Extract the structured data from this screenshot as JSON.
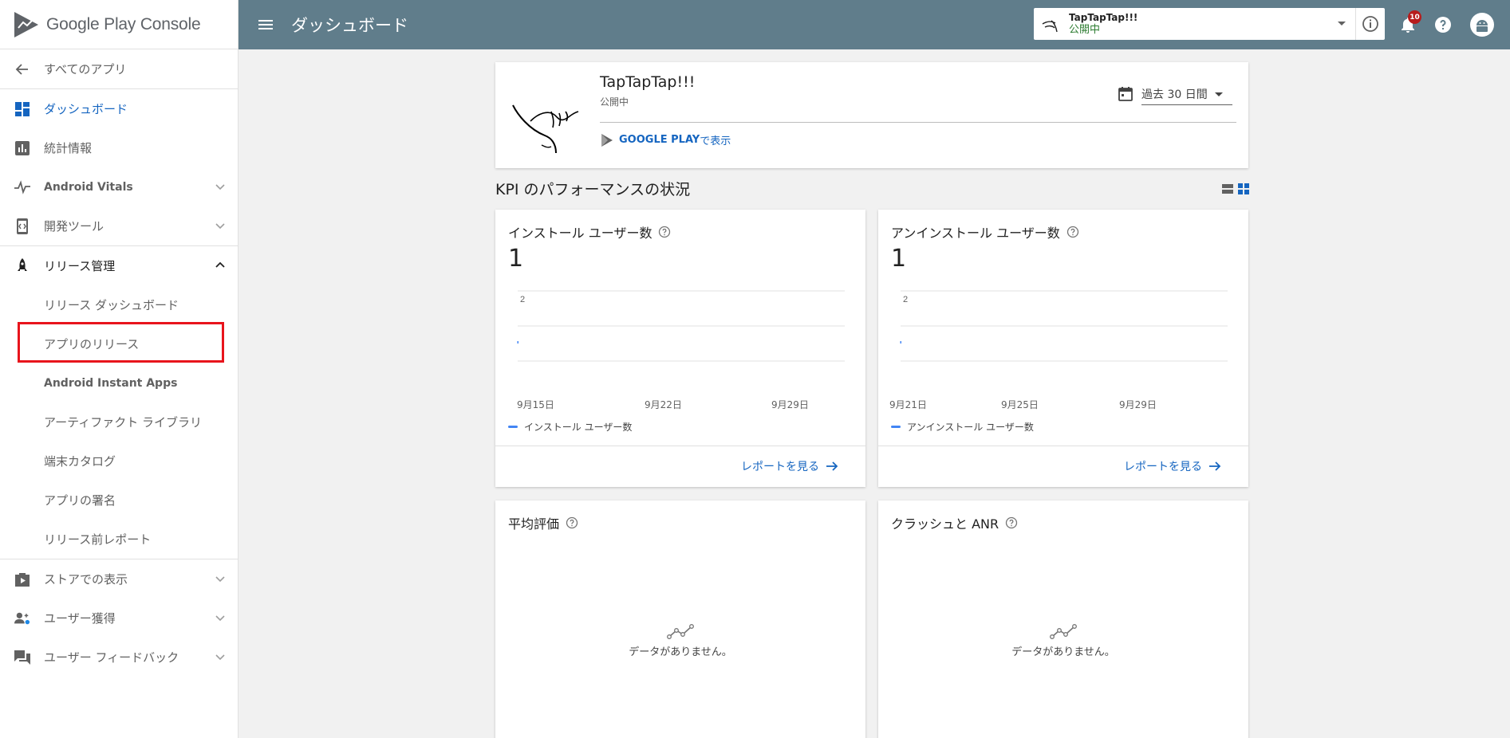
{
  "brand": {
    "logo_text": "Google Play Console"
  },
  "topbar": {
    "title": "ダッシュボード",
    "app_name": "TapTapTap!!!",
    "app_status": "公開中",
    "notification_count": "10"
  },
  "sidebar": {
    "back_label": "すべてのアプリ",
    "items": [
      {
        "label": "ダッシュボード",
        "icon": "dashboard-icon"
      },
      {
        "label": "統計情報",
        "icon": "bar-chart-icon"
      },
      {
        "label": "Android Vitals",
        "icon": "pulse-icon"
      },
      {
        "label": "開発ツール",
        "icon": "dev-tools-icon"
      },
      {
        "label": "リリース管理",
        "icon": "rocket-icon"
      }
    ],
    "release_sub": [
      "リリース ダッシュボード",
      "アプリのリリース",
      "Android Instant Apps",
      "アーティファクト ライブラリ",
      "端末カタログ",
      "アプリの署名",
      "リリース前レポート"
    ],
    "bottom_items": [
      {
        "label": "ストアでの表示",
        "icon": "store-icon"
      },
      {
        "label": "ユーザー獲得",
        "icon": "user-acquisition-icon"
      },
      {
        "label": "ユーザー フィードバック",
        "icon": "feedback-icon"
      }
    ]
  },
  "app_card": {
    "name": "TapTapTap!!!",
    "status": "公開中",
    "logo_text": "TapTapTap!!!",
    "gplay_label_bold": "GOOGLE PLAY",
    "gplay_label_rest": " で表示",
    "date_range": "過去 30 日間"
  },
  "kpi_section": {
    "title": "KPI のパフォーマンスの状況"
  },
  "kpi_cards": [
    {
      "title": "インストール ユーザー数",
      "value": "1",
      "legend": "インストール ユーザー数",
      "report_label": "レポートを見る",
      "y_tick": "2",
      "x_ticks": [
        "9月15日",
        "9月22日",
        "9月29日"
      ]
    },
    {
      "title": "アンインストール ユーザー数",
      "value": "1",
      "legend": "アンインストール ユーザー数",
      "report_label": "レポートを見る",
      "y_tick": "2",
      "x_ticks": [
        "9月21日",
        "9月25日",
        "9月29日"
      ]
    }
  ],
  "empty_cards": [
    {
      "title": "平均評価",
      "message": "データがありません。"
    },
    {
      "title": "クラッシュと ANR",
      "message": "データがありません。"
    }
  ],
  "colors": {
    "topbar": "#607d8b",
    "accent": "#1565c0",
    "status_green": "#2e7d32",
    "highlight": "#e8141c"
  }
}
